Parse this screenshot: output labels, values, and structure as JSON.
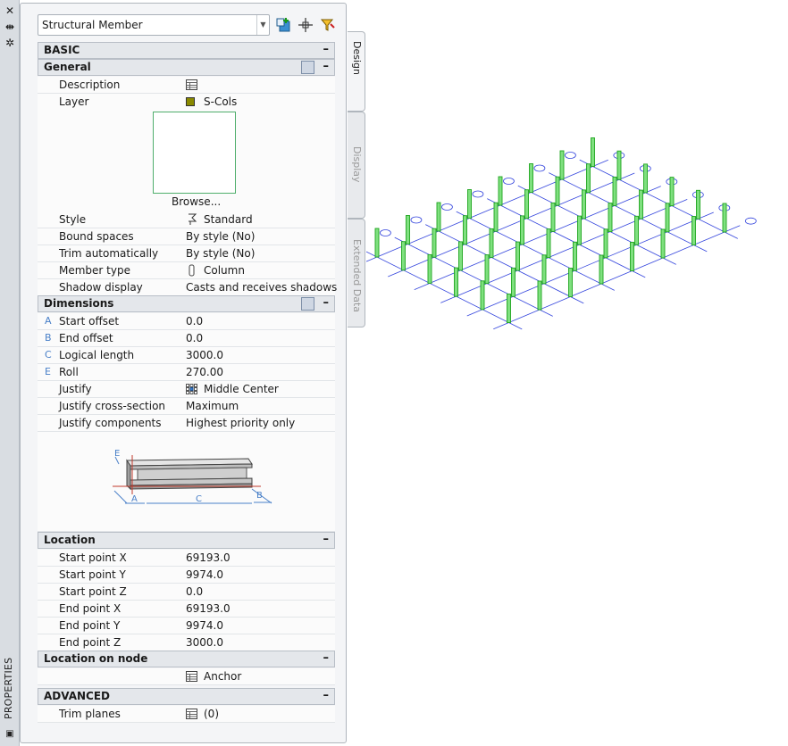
{
  "palette": {
    "title": "PROPERTIES",
    "close_icon": "close-icon",
    "autohide_icon": "autohide-icon",
    "settings_icon": "gear-icon"
  },
  "toolbar": {
    "object_type": "Structural Member",
    "icons": [
      "add-selection-icon",
      "pick-point-icon",
      "quick-select-icon"
    ]
  },
  "tabs": [
    {
      "label": "Design",
      "active": true
    },
    {
      "label": "Display",
      "active": false
    },
    {
      "label": "Extended Data",
      "active": false
    }
  ],
  "sections": {
    "basic": {
      "title": "BASIC",
      "toggle": "–"
    },
    "general": {
      "title": "General",
      "toggle": "–",
      "rows": [
        {
          "label": "Description",
          "value": "",
          "icon": "table-icon"
        },
        {
          "label": "Layer",
          "value": "S-Cols",
          "icon": "layer-swatch-icon",
          "swatch_color": "#8a8a00"
        }
      ],
      "browse_label": "Browse...",
      "rows2": [
        {
          "label": "Style",
          "value": "Standard",
          "icon": "style-icon"
        },
        {
          "label": "Bound spaces",
          "value": "By style (No)"
        },
        {
          "label": "Trim automatically",
          "value": "By style (No)"
        },
        {
          "label": "Member type",
          "value": "Column",
          "icon": "column-icon"
        },
        {
          "label": "Shadow display",
          "value": "Casts and receives shadows"
        }
      ]
    },
    "dimensions": {
      "title": "Dimensions",
      "toggle": "–",
      "rows": [
        {
          "letter": "A",
          "label": "Start offset",
          "value": "0.0"
        },
        {
          "letter": "B",
          "label": "End offset",
          "value": "0.0"
        },
        {
          "letter": "C",
          "label": "Logical length",
          "value": "3000.0"
        },
        {
          "letter": "E",
          "label": "Roll",
          "value": "270.00"
        },
        {
          "letter": "",
          "label": "Justify",
          "value": "Middle Center",
          "icon": "justify-grid-icon"
        },
        {
          "letter": "",
          "label": "Justify cross-section",
          "value": "Maximum"
        },
        {
          "letter": "",
          "label": "Justify components",
          "value": "Highest priority only"
        }
      ],
      "diagram_labels": {
        "e": "E",
        "a": "A",
        "c": "C",
        "b": "B"
      }
    },
    "location": {
      "title": "Location",
      "toggle": "–",
      "rows": [
        {
          "label": "Start point X",
          "value": "69193.0"
        },
        {
          "label": "Start point Y",
          "value": "9974.0"
        },
        {
          "label": "Start point Z",
          "value": "0.0"
        },
        {
          "label": "End point X",
          "value": "69193.0"
        },
        {
          "label": "End point Y",
          "value": "9974.0"
        },
        {
          "label": "End point Z",
          "value": "3000.0"
        }
      ]
    },
    "location_on_node": {
      "title": "Location on node",
      "toggle": "–",
      "rows": [
        {
          "label": "",
          "value": "Anchor",
          "icon": "table-icon"
        }
      ]
    },
    "advanced": {
      "title": "ADVANCED",
      "toggle": "–",
      "rows": [
        {
          "label": "Trim planes",
          "value": "(0)",
          "icon": "table-icon"
        }
      ]
    }
  },
  "colors": {
    "column_green": "#1fa51f",
    "grid_blue": "#3344dd",
    "dimension_blue": "#4a80c8"
  }
}
